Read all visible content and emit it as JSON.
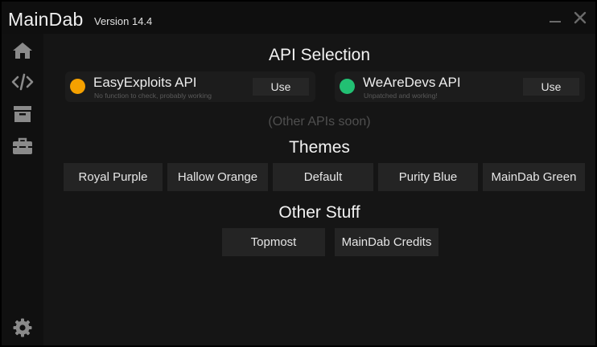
{
  "titlebar": {
    "title": "MainDab",
    "version": "Version 14.4",
    "minimize_icon": "minimize-icon",
    "close_icon": "close-icon"
  },
  "sidebar": {
    "items": [
      {
        "icon": "home-icon"
      },
      {
        "icon": "code-icon"
      },
      {
        "icon": "archive-icon"
      },
      {
        "icon": "toolbox-icon"
      }
    ],
    "settings_icon": "gear-icon"
  },
  "api_section": {
    "heading": "API Selection",
    "apis": [
      {
        "name": "EasyExploits API",
        "status": "No function to check, probably working",
        "status_color": "#f5a100",
        "button": "Use"
      },
      {
        "name": "WeAreDevs API",
        "status": "Unpatched and working!",
        "status_color": "#22c073",
        "button": "Use"
      }
    ],
    "note": "(Other APIs soon)"
  },
  "themes": {
    "heading": "Themes",
    "items": [
      "Royal Purple",
      "Hallow Orange",
      "Default",
      "Purity Blue",
      "MainDab Green"
    ]
  },
  "other": {
    "heading": "Other Stuff",
    "items": [
      "Topmost",
      "MainDab Credits"
    ]
  },
  "colors": {
    "background": "#151515",
    "titlebar": "#0f0f0f",
    "sidebar": "#101010",
    "button": "#242424"
  }
}
